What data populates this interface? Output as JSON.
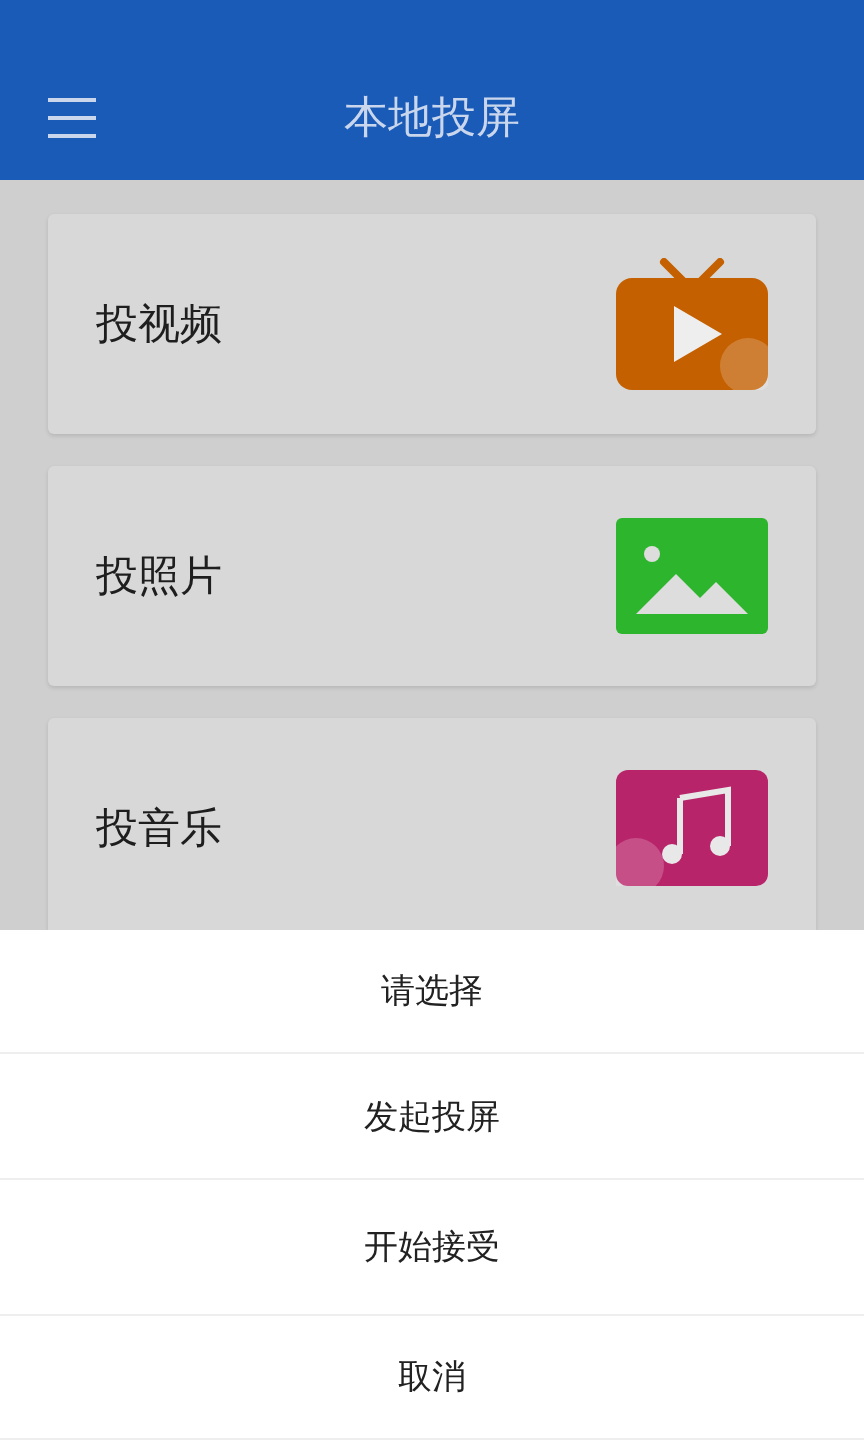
{
  "header": {
    "title": "本地投屏"
  },
  "cards": [
    {
      "label": "投视频",
      "kind": "video",
      "color": "#c46000"
    },
    {
      "label": "投照片",
      "kind": "photo",
      "color": "#2eb52e"
    },
    {
      "label": "投音乐",
      "kind": "music",
      "color": "#b8246a"
    }
  ],
  "sheet": {
    "title": "请选择",
    "options": [
      "发起投屏",
      "开始接受"
    ],
    "cancel": "取消"
  }
}
